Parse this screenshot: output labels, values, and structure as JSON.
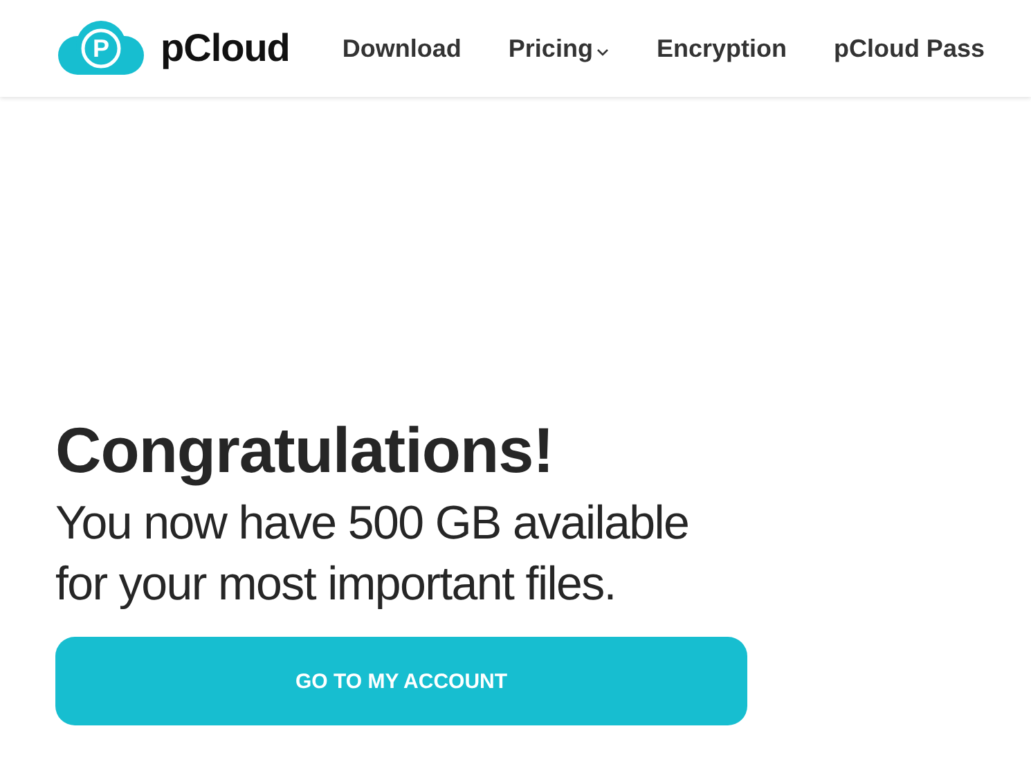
{
  "logo": {
    "mark": "P",
    "name": "pCloud"
  },
  "nav": [
    {
      "label": "Download",
      "dropdown": false
    },
    {
      "label": "Pricing",
      "dropdown": true
    },
    {
      "label": "Encryption",
      "dropdown": false
    },
    {
      "label": "pCloud Pass",
      "dropdown": false
    }
  ],
  "heading": "Congratulations!",
  "message": "You now have 500 GB available for your most important files.",
  "button": "GO TO MY ACCOUNT"
}
